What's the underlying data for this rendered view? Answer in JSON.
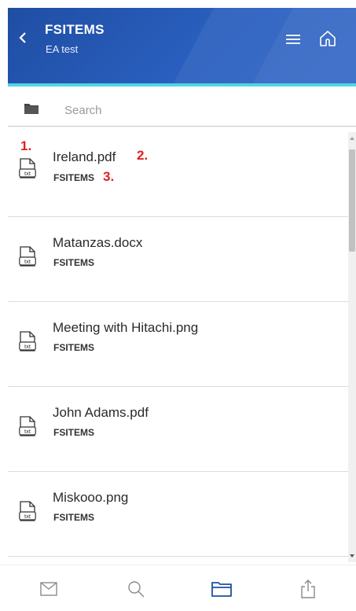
{
  "header": {
    "title": "FSITEMS",
    "subtitle": "EA test"
  },
  "search": {
    "placeholder": "Search",
    "value": ""
  },
  "files": [
    {
      "name": "Ireland.pdf",
      "source": "FSITEMS",
      "icon_label": "txt"
    },
    {
      "name": "Matanzas.docx",
      "source": "FSITEMS",
      "icon_label": "txt"
    },
    {
      "name": "Meeting with Hitachi.png",
      "source": "FSITEMS",
      "icon_label": "txt"
    },
    {
      "name": "John Adams.pdf",
      "source": "FSITEMS",
      "icon_label": "txt"
    },
    {
      "name": "Miskooo.png",
      "source": "FSITEMS",
      "icon_label": "txt"
    }
  ],
  "annotations": {
    "m1": "1.",
    "m2": "2.",
    "m3": "3."
  },
  "tabs": [
    {
      "icon": "mail-icon",
      "active": false
    },
    {
      "icon": "search-icon",
      "active": false
    },
    {
      "icon": "folder-icon",
      "active": true
    },
    {
      "icon": "share-icon",
      "active": false
    }
  ],
  "colors": {
    "header_bg": "#2a5fbf",
    "header_accent": "#4fd6e3",
    "active_tab": "#1f4ea3",
    "inactive_tab": "#8a8a8a",
    "annotation": "#e02020"
  }
}
